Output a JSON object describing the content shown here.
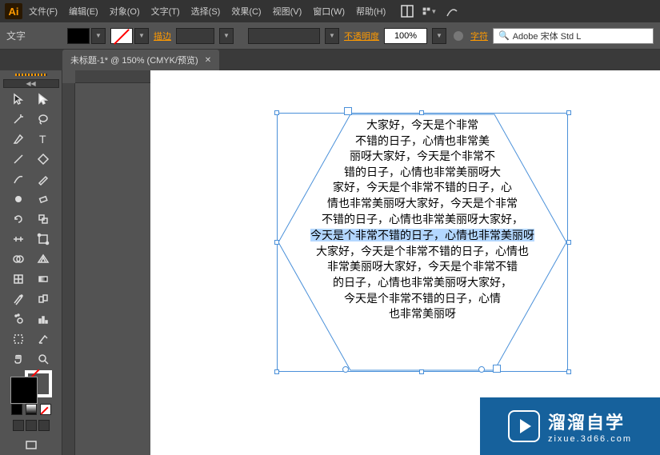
{
  "app": {
    "logo": "Ai"
  },
  "menu": {
    "file": "文件(F)",
    "edit": "编辑(E)",
    "object": "对象(O)",
    "type": "文字(T)",
    "select": "选择(S)",
    "effect": "效果(C)",
    "view": "视图(V)",
    "window": "窗口(W)",
    "help": "帮助(H)"
  },
  "control": {
    "tool_label": "文字",
    "stroke_label": "描边",
    "stroke_value": "",
    "opacity_label": "不透明度",
    "opacity_value": "100%",
    "char_label": "字符",
    "font_name": "Adobe 宋体 Std L",
    "font_icon": "🔍"
  },
  "tab": {
    "title": "未标题-1* @ 150% (CMYK/预览)"
  },
  "tools": [
    {
      "name": "selection-tool",
      "glyph": "sel"
    },
    {
      "name": "direct-selection-tool",
      "glyph": "dsel"
    },
    {
      "name": "magic-wand-tool",
      "glyph": "wand"
    },
    {
      "name": "lasso-tool",
      "glyph": "lasso"
    },
    {
      "name": "pen-tool",
      "glyph": "pen"
    },
    {
      "name": "type-tool",
      "glyph": "type"
    },
    {
      "name": "line-tool",
      "glyph": "line"
    },
    {
      "name": "rectangle-tool",
      "glyph": "rect"
    },
    {
      "name": "paintbrush-tool",
      "glyph": "brush"
    },
    {
      "name": "pencil-tool",
      "glyph": "pencil"
    },
    {
      "name": "blob-brush-tool",
      "glyph": "blob"
    },
    {
      "name": "eraser-tool",
      "glyph": "eraser"
    },
    {
      "name": "rotate-tool",
      "glyph": "rotate"
    },
    {
      "name": "scale-tool",
      "glyph": "scale"
    },
    {
      "name": "width-tool",
      "glyph": "width"
    },
    {
      "name": "free-transform-tool",
      "glyph": "ft"
    },
    {
      "name": "shape-builder-tool",
      "glyph": "sb"
    },
    {
      "name": "perspective-tool",
      "glyph": "persp"
    },
    {
      "name": "mesh-tool",
      "glyph": "mesh"
    },
    {
      "name": "gradient-tool",
      "glyph": "grad"
    },
    {
      "name": "eyedropper-tool",
      "glyph": "eye"
    },
    {
      "name": "blend-tool",
      "glyph": "blend"
    },
    {
      "name": "symbol-sprayer-tool",
      "glyph": "spray"
    },
    {
      "name": "column-graph-tool",
      "glyph": "graph"
    },
    {
      "name": "artboard-tool",
      "glyph": "art"
    },
    {
      "name": "slice-tool",
      "glyph": "slice"
    },
    {
      "name": "hand-tool",
      "glyph": "hand"
    },
    {
      "name": "zoom-tool",
      "glyph": "zoom"
    }
  ],
  "hex_text": [
    "大家好，今天是个非常",
    "不错的日子，心情也非常美",
    "丽呀大家好，今天是个非常不",
    "错的日子，心情也非常美丽呀大",
    "家好，今天是个非常不错的日子，心",
    "情也非常美丽呀大家好，今天是个非常",
    "不错的日子，心情也非常美丽呀大家好，",
    "今天是个非常不错的日子，心情也非常美丽呀",
    "大家好，今天是个非常不错的日子，心情也",
    "非常美丽呀大家好，今天是个非常不错",
    "的日子，心情也非常美丽呀大家好，",
    "今天是个非常不错的日子，心情",
    "也非常美丽呀"
  ],
  "watermark": {
    "brand_cn": "溜溜自学",
    "brand_url": "zixue.3d66.com"
  }
}
